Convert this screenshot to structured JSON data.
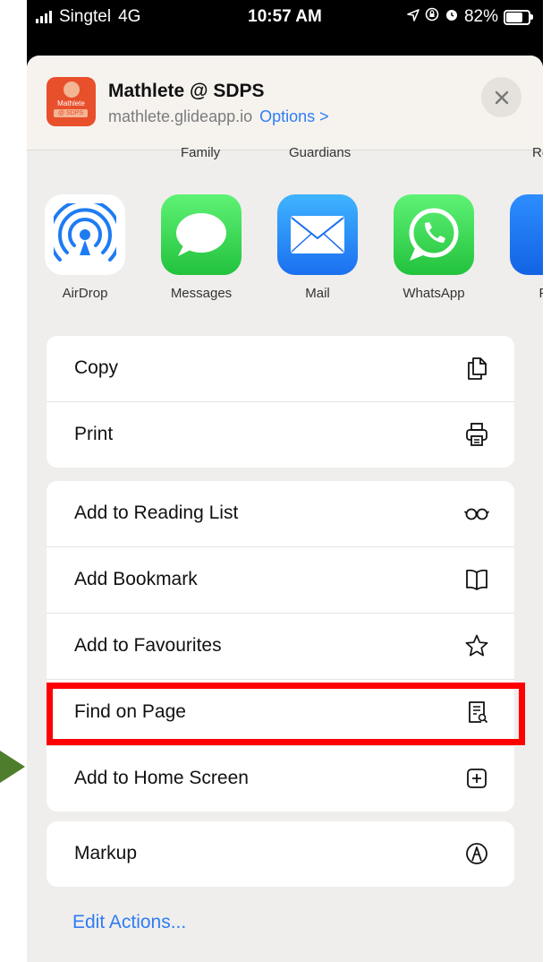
{
  "status_bar": {
    "carrier": "Singtel",
    "network": "4G",
    "time": "10:57 AM",
    "battery": "82%"
  },
  "share_header": {
    "app_name": "Mathlete @ SDPS",
    "url": "mathlete.glideapp.io",
    "options_label": "Options >",
    "icon_text_top": "Mathlete",
    "icon_text_bottom": "@ SDPS"
  },
  "contacts": [
    "Family",
    "Guardians",
    "Re"
  ],
  "share_apps": [
    {
      "label": "AirDrop",
      "icon": "airdrop-icon"
    },
    {
      "label": "Messages",
      "icon": "messages-icon"
    },
    {
      "label": "Mail",
      "icon": "mail-icon"
    },
    {
      "label": "WhatsApp",
      "icon": "whatsapp-icon"
    },
    {
      "label": "Fac",
      "icon": "facebook-icon"
    }
  ],
  "group1": [
    {
      "label": "Copy",
      "icon": "copy-icon"
    },
    {
      "label": "Print",
      "icon": "print-icon"
    }
  ],
  "group2": [
    {
      "label": "Add to Reading List",
      "icon": "glasses-icon"
    },
    {
      "label": "Add Bookmark",
      "icon": "book-icon"
    },
    {
      "label": "Add to Favourites",
      "icon": "star-icon"
    },
    {
      "label": "Find on Page",
      "icon": "find-doc-icon"
    },
    {
      "label": "Add to Home Screen",
      "icon": "plus-square-icon"
    }
  ],
  "group3": [
    {
      "label": "Markup",
      "icon": "markup-icon"
    }
  ],
  "edit_actions": "Edit Actions...",
  "colors": {
    "accent": "#2f7cf6",
    "highlight": "#ff0000",
    "arrow": "#4e7d2b"
  }
}
